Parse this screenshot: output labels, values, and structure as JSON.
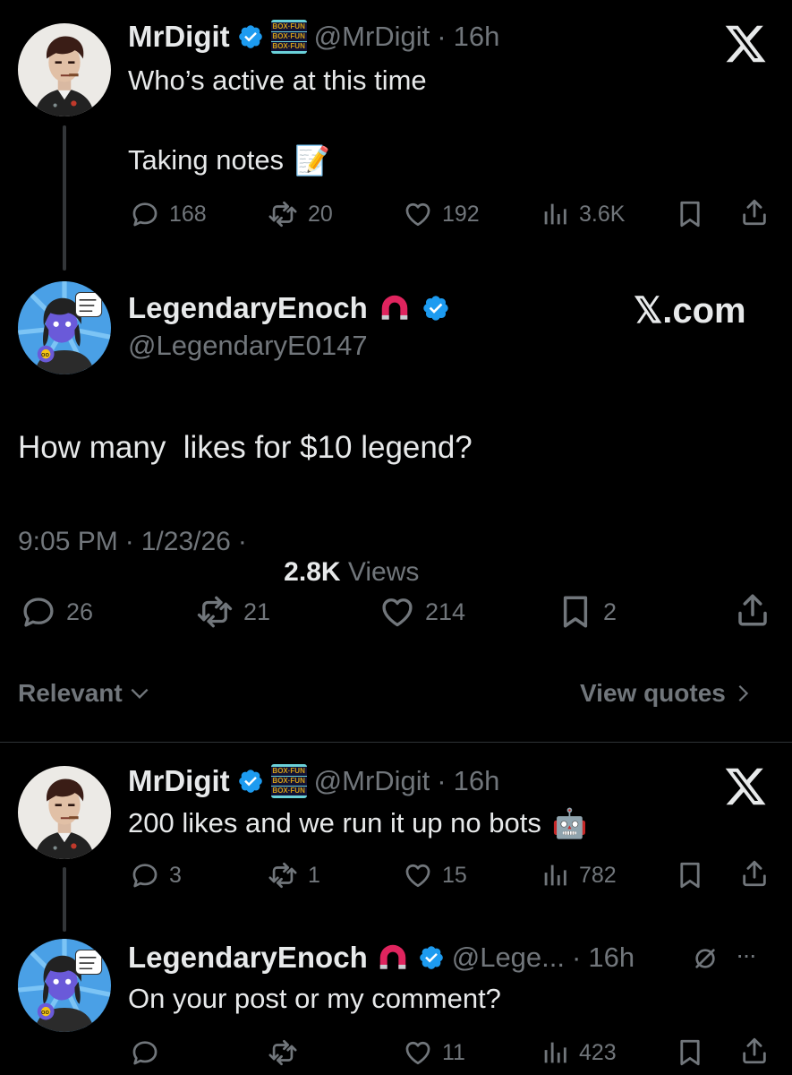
{
  "post1": {
    "name": "MrDigit",
    "badge_lines": [
      "BOX·FUN",
      "BOX·FUN",
      "BOX·FUN"
    ],
    "handle": "@MrDigit",
    "separator": "·",
    "time": "16h",
    "text_line1": "Who’s active at this time",
    "text_line2": "Taking notes",
    "text_emoji": "📝",
    "replies": "168",
    "reposts": "20",
    "likes": "192",
    "views": "3.6K",
    "corner_icon": "x-logo-icon"
  },
  "main_post": {
    "name": "LegendaryEnoch",
    "name_emoji": "magnet-icon",
    "handle": "@LegendaryE0147",
    "corner_text": "𝕏.com",
    "text": "How many  likes for $10 legend?",
    "time": "9:05 PM",
    "separator": "·",
    "date": "1/23/26",
    "views_count": "2.8K",
    "views_label": " Views",
    "replies": "26",
    "reposts": "21",
    "likes": "214",
    "bookmarks": "2"
  },
  "sort_bar": {
    "relevant_label": "Relevant",
    "view_quotes_label": "View quotes"
  },
  "reply1": {
    "name": "MrDigit",
    "handle": "@MrDigit",
    "separator": "·",
    "time": "16h",
    "text": "200 likes and we run it up no bots",
    "text_emoji": "🤖",
    "replies": "3",
    "reposts": "1",
    "likes": "15",
    "views": "782"
  },
  "reply2": {
    "name": "LegendaryEnoch",
    "handle": "@Lege...",
    "separator": "·",
    "time": "16h",
    "text": "On your post or my comment?",
    "more": "···",
    "replies": "",
    "reposts": "",
    "likes": "11",
    "views": "423"
  },
  "colors": {
    "background": "#000000",
    "text": "#e7e9ea",
    "muted": "#71767b",
    "verified_blue": "#1d9bf0",
    "magnet_red": "#e0245e",
    "divider": "#2f3336"
  }
}
